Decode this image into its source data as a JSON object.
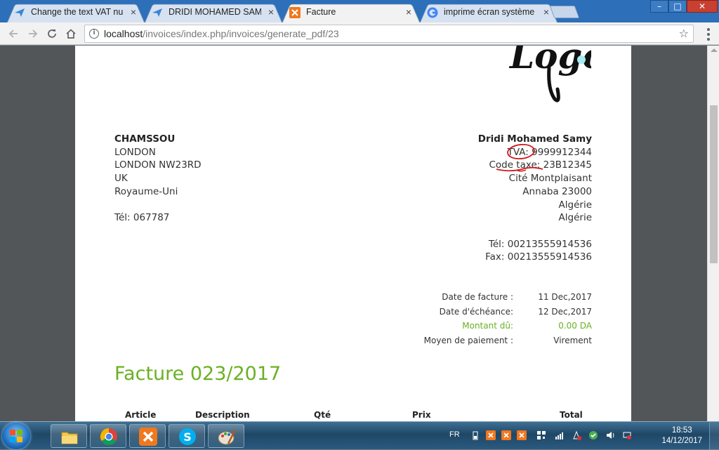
{
  "browser": {
    "tabs": [
      {
        "label": "Change the text VAT num",
        "icon": "blue-arrow-icon",
        "active": false
      },
      {
        "label": "DRIDI MOHAMED SAMY",
        "icon": "blue-arrow-icon",
        "active": false
      },
      {
        "label": "Facture",
        "icon": "xampp-icon",
        "active": true
      },
      {
        "label": "imprime écran système s",
        "icon": "google-icon",
        "active": false
      }
    ],
    "tab_close": "×",
    "url_host": "localhost",
    "url_path": "/invoices/index.php/invoices/generate_pdf/23",
    "window_buttons": {
      "minimize": "–",
      "maximize": "□",
      "close": "✕"
    }
  },
  "invoice": {
    "logo_text": "Logo",
    "client": {
      "name": "CHAMSSOU",
      "lines": [
        "LONDON",
        "LONDON NW23RD",
        "UK",
        "Royaume-Uni"
      ],
      "phone": "Tél: 067787"
    },
    "company": {
      "name": "Dridi Mohamed Samy",
      "vat_label": "TVA:",
      "vat_value": " 9999912344",
      "tax_label": "Code taxe",
      "tax_value": ": 23B12345",
      "lines": [
        "Cité Montplaisant",
        "Annaba 23000",
        "Algérie",
        "Algérie"
      ],
      "phone": "Tél: 00213555914536",
      "fax": "Fax: 00213555914536"
    },
    "meta": [
      {
        "label": "Date de facture :",
        "value": "11 Dec,2017"
      },
      {
        "label": "Date d'échéance:",
        "value": "12 Dec,2017"
      },
      {
        "label": "Montant dû:",
        "value": "0.00 DA",
        "highlight": true
      },
      {
        "label": "Moyen de paiement :",
        "value": "Virement"
      }
    ],
    "title": "Facture 023/2017",
    "table_headers": [
      "Article",
      "Description",
      "Qté",
      "Prix",
      "Total"
    ],
    "accent_color": "#6ab023",
    "annotation_color": "#d0181b"
  },
  "taskbar": {
    "apps": [
      "file-explorer-icon",
      "chrome-icon",
      "xampp-icon",
      "skype-icon",
      "paint-icon"
    ],
    "language": "FR",
    "time": "18:53",
    "date": "14/12/2017"
  }
}
